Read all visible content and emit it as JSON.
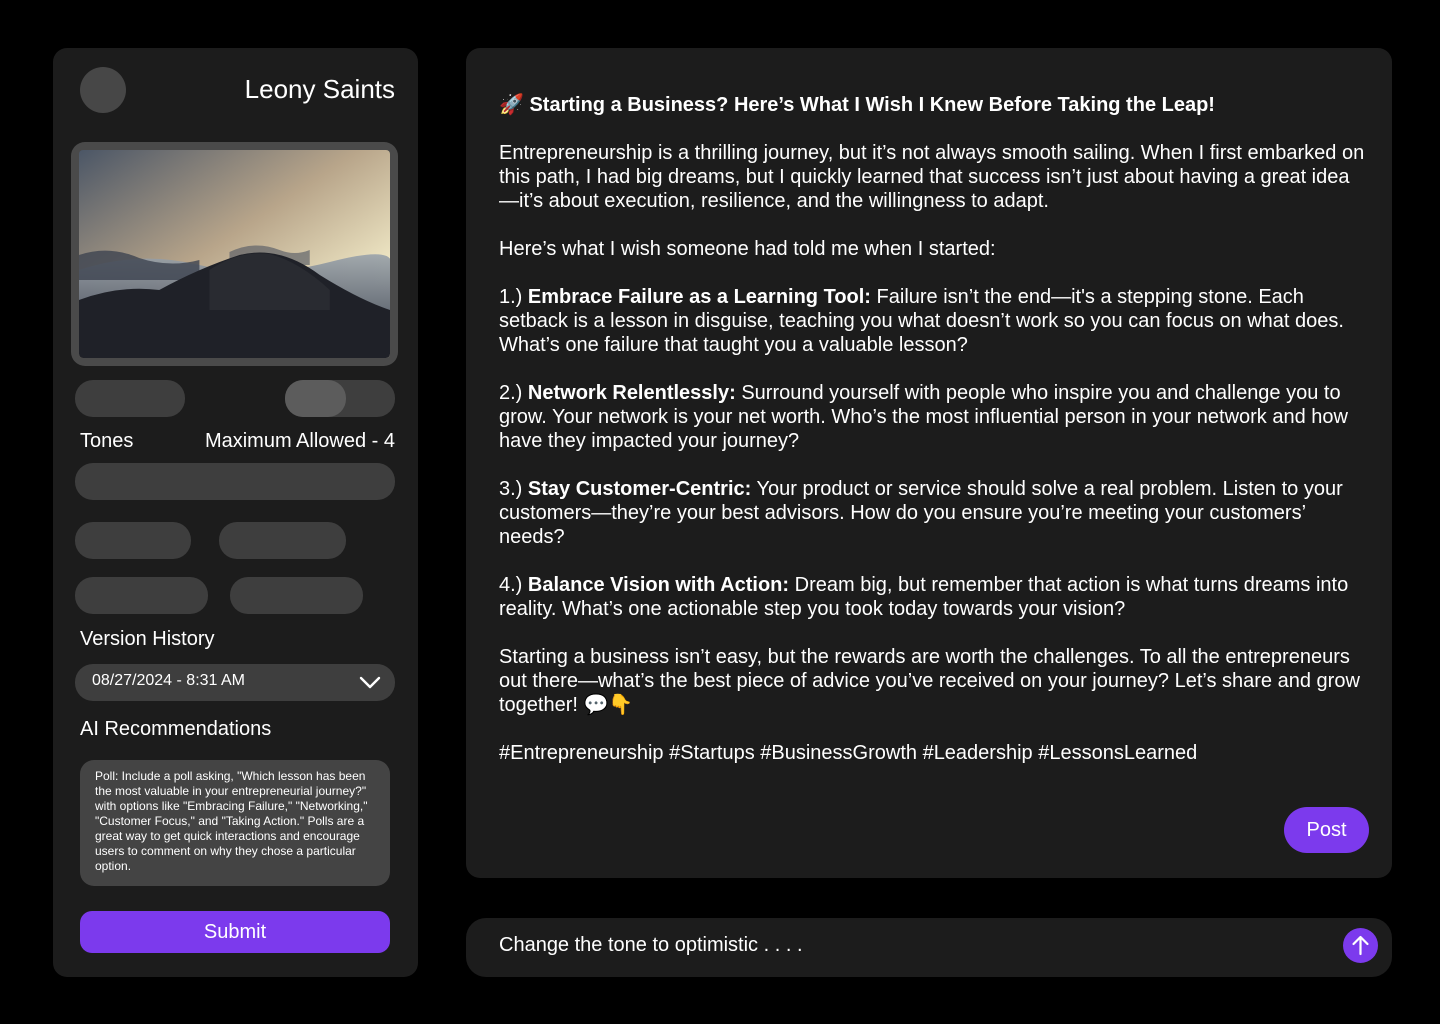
{
  "user": {
    "name": "Leony Saints"
  },
  "sidebar": {
    "tones_label": "Tones",
    "max_allowed_label": "Maximum Allowed - 4",
    "version_history_label": "Version History",
    "version_selected": "08/27/2024 - 8:31 AM",
    "ai_reco_label": "AI Recommendations",
    "ai_reco_text": "Poll: Include a poll asking, \"Which lesson has been the most valuable in your entrepreneurial journey?\" with options like \"Embracing Failure,\" \"Networking,\" \"Customer Focus,\" and \"Taking Action.\" Polls are a great way to get quick interactions and encourage users to comment on why they chose a particular option.",
    "submit_label": "Submit"
  },
  "post": {
    "title": "🚀 Starting a Business? Here’s What I Wish I Knew Before Taking the Leap!",
    "intro": "Entrepreneurship is a thrilling journey, but it’s not always smooth sailing. When I first embarked on this path, I had big dreams, but I quickly learned that success isn’t just about having a great idea—it’s about execution, resilience, and the willingness to adapt.",
    "lead": "Here’s what I wish someone had told me when I started:",
    "points": [
      {
        "num": "1.)",
        "head": "Embrace Failure as a Learning Tool:",
        "body": "Failure isn’t the end—it's a stepping stone. Each setback is a lesson in disguise, teaching you what doesn’t work so you can focus on what does. What’s one failure that taught you a valuable lesson?"
      },
      {
        "num": "2.)",
        "head": "Network Relentlessly:",
        "body": "Surround yourself with people who inspire you and challenge you to grow. Your network is your net worth. Who’s the most influential person in your network and how have they impacted your journey?"
      },
      {
        "num": "3.)",
        "head": "Stay Customer-Centric:",
        "body": "Your product or service should solve a real problem. Listen to your customers—they’re your best advisors. How do you ensure you’re meeting your customers’ needs?"
      },
      {
        "num": "4.)",
        "head": "Balance Vision with Action:",
        "body": "Dream big, but remember that action is what turns dreams into reality. What’s one actionable step you took today towards your vision?"
      }
    ],
    "closing": "Starting a business isn’t easy, but the rewards are worth the challenges. To all the entrepreneurs out there—what’s the best piece of advice you’ve received on your journey? Let’s share and grow together! 💬👇",
    "hashtags": "#Entrepreneurship #Startups #BusinessGrowth #Leadership #LessonsLearned",
    "post_label": "Post"
  },
  "prompt": {
    "value": "Change the tone to optimistic . . . ."
  },
  "colors": {
    "accent": "#7c3aed",
    "panel": "#1c1c1c",
    "control": "#3e3e3e"
  }
}
